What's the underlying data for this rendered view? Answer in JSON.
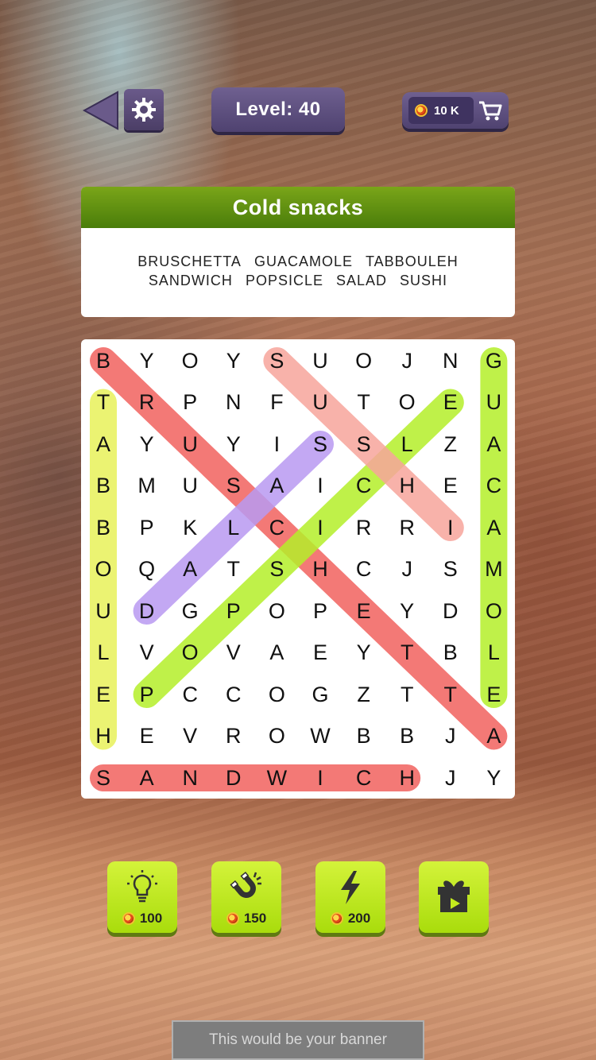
{
  "header": {
    "back_icon": "back-arrow-icon",
    "settings_icon": "gear-icon",
    "level_text": "Level: 40",
    "coins_text": "10 K",
    "cart_icon": "cart-icon"
  },
  "category": {
    "title": "Cold snacks",
    "words_line1": [
      "BRUSCHETTA",
      "GUACAMOLE",
      "TABBOULEH"
    ],
    "words_line2": [
      "SANDWICH",
      "POPSICLE",
      "SALAD",
      "SUSHI"
    ]
  },
  "grid": {
    "rows": [
      "BYOYSUOJNG",
      "TRPNFUTOEU",
      "AYUYISSLZA",
      "BMUSAICHEC",
      "BPKLCIRRIA",
      "OQATSHCJSM",
      "UDGPOPEYDO",
      "LVOVAEYTBL",
      "EPCCOGZTTE",
      "HEVROWBBJA",
      "SANDWICHJY"
    ],
    "found": [
      {
        "word": "BRUSCHETTA",
        "from": [
          0,
          0
        ],
        "to": [
          9,
          9
        ],
        "color": "#f2625f"
      },
      {
        "word": "GUACAMOLE",
        "from": [
          0,
          9
        ],
        "to": [
          8,
          9
        ],
        "color": "#b5ef2a"
      },
      {
        "word": "TABBOULEH",
        "from": [
          1,
          0
        ],
        "to": [
          9,
          0
        ],
        "color": "#e8f25a"
      },
      {
        "word": "SANDWICH",
        "from": [
          10,
          0
        ],
        "to": [
          10,
          7
        ],
        "color": "#f2625f"
      },
      {
        "word": "POPSICLE",
        "from": [
          8,
          1
        ],
        "to": [
          1,
          8
        ],
        "color": "#b5ef2a"
      },
      {
        "word": "SALAD",
        "from": [
          2,
          5
        ],
        "to": [
          6,
          1
        ],
        "color": "#b99af2"
      },
      {
        "word": "SUSHI",
        "from": [
          0,
          4
        ],
        "to": [
          4,
          8
        ],
        "color": "#f7a59c"
      }
    ]
  },
  "boosters": [
    {
      "icon": "lightbulb-icon",
      "price": "100"
    },
    {
      "icon": "magnet-icon",
      "price": "150"
    },
    {
      "icon": "lightning-icon",
      "price": "200"
    },
    {
      "icon": "gift-video-icon",
      "price": ""
    }
  ],
  "banner_text": "This would be your banner"
}
